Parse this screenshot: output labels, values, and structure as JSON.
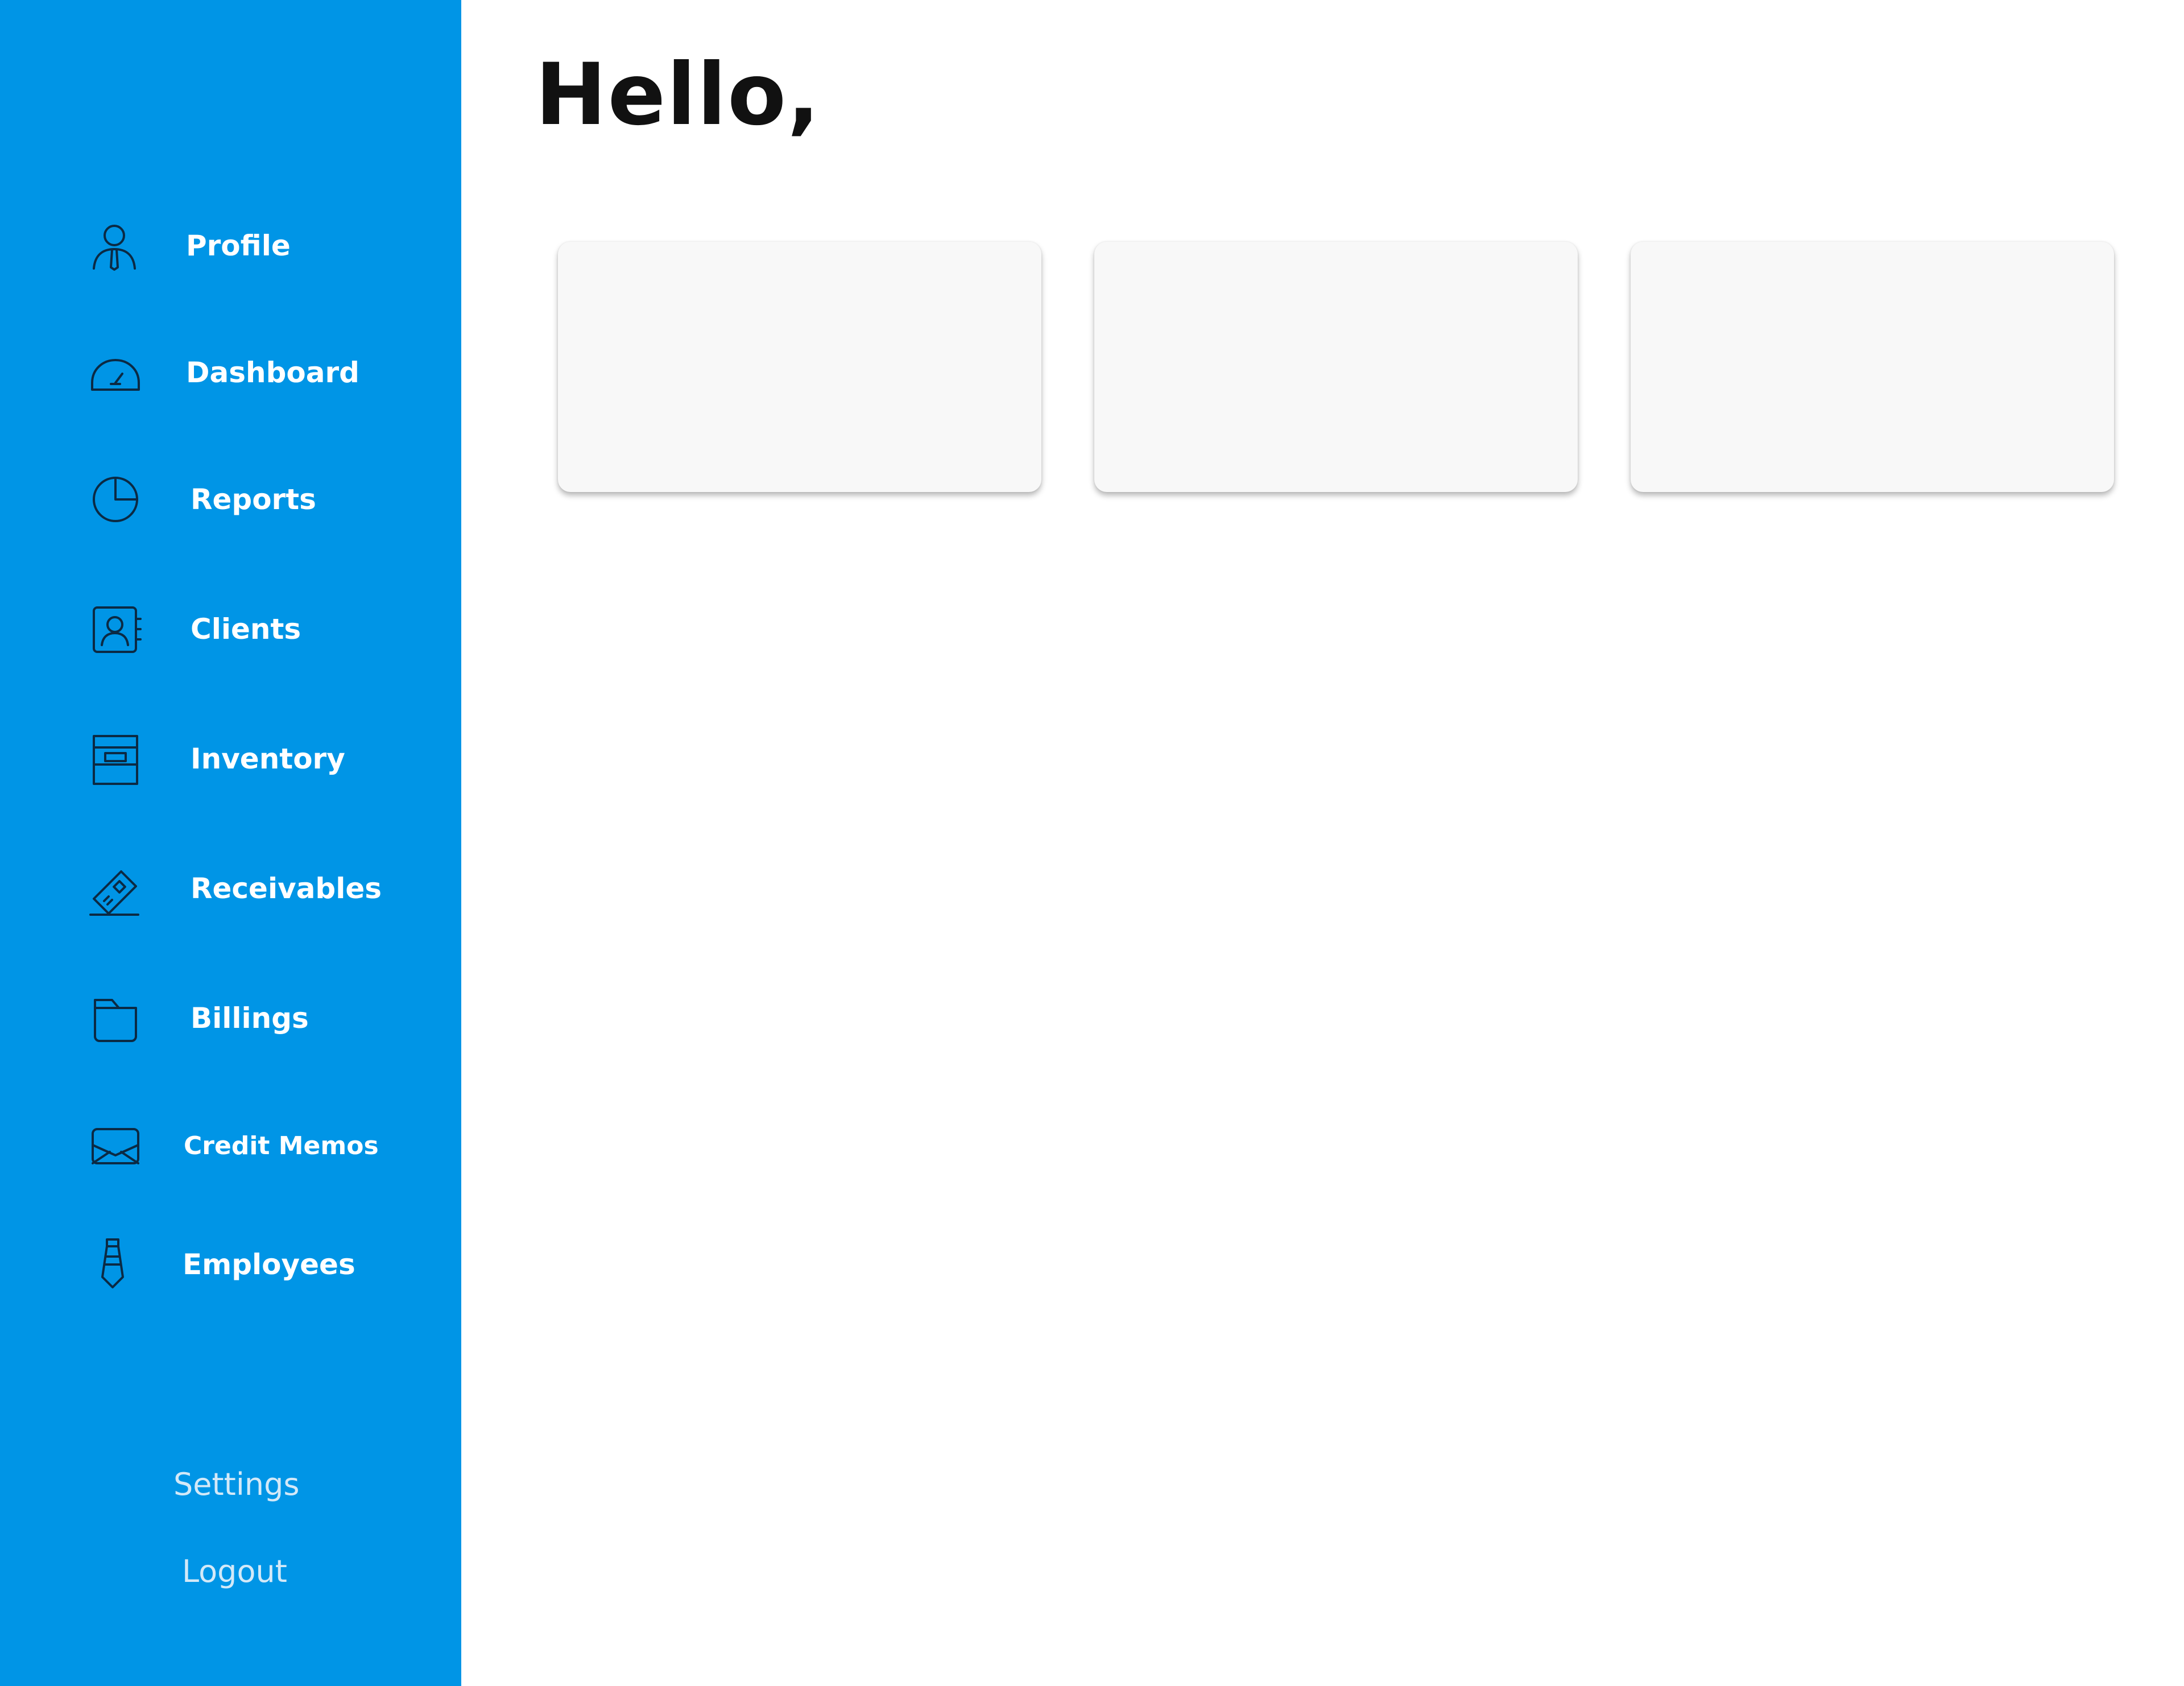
{
  "colors": {
    "sidebar_bg": "#0095e6",
    "main_bg": "#ffffff",
    "card_bg": "#f8f8f8",
    "icon_stroke": "#0b2a44",
    "nav_text": "#ffffff",
    "bottom_link_text": "#d3e9f8"
  },
  "sidebar": {
    "items": [
      {
        "label": "Profile",
        "icon": "person-icon"
      },
      {
        "label": "Dashboard",
        "icon": "gauge-icon"
      },
      {
        "label": "Reports",
        "icon": "pie-chart-icon"
      },
      {
        "label": "Clients",
        "icon": "contact-card-icon"
      },
      {
        "label": "Inventory",
        "icon": "archive-drawer-icon"
      },
      {
        "label": "Receivables",
        "icon": "ticket-icon"
      },
      {
        "label": "Billings",
        "icon": "folder-icon"
      },
      {
        "label": "Credit Memos",
        "icon": "envelope-icon"
      },
      {
        "label": "Employees",
        "icon": "tie-icon"
      }
    ],
    "settings_label": "Settings",
    "logout_label": "Logout"
  },
  "main": {
    "greeting": "Hello,"
  }
}
